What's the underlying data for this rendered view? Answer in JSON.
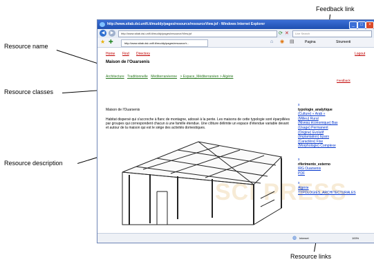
{
  "annotations": {
    "resource_name": "Resource name",
    "resource_classes": "Resource classes",
    "resource_description": "Resource description",
    "feedback_link": "Feedback link",
    "resource_links": "Resource links"
  },
  "browser": {
    "title": "http://www.sitab.dsi.unifi.it/muddy/pages/resource/resourceView.jsf - Windows Internet Explorer",
    "address": "http://www.sitab.dsi.unifi.it/muddy/pages/resource/View.jsf",
    "search_placeholder": "Live Search",
    "tab_label": "http://www.sitab.dsi.unifi.it/muddy/pages/resource/r...",
    "page_menu": "Pagina",
    "tools_menu": "Strumenti",
    "status_zone": "Internet",
    "zoom": "100%"
  },
  "page": {
    "nav_home": "Home",
    "nav_find": "Find",
    "nav_directory": "Directory",
    "logout": "Logout",
    "resource_name": "Maison de l'Ouarsenis",
    "classes": [
      "Architecture",
      "Traditionnelle",
      "Méditerranéenne",
      "> Espace_Méditerranéen > Algérie"
    ],
    "feedback": "Feedback",
    "description_title": "Maison de l'Ouarsenis",
    "description_body": "Habitat dispersé qui s'accroche à flanc de montagne, adossé à la pente. Les maisons de cette typologie sont éparpillées par groupes qui correspondent chacun à une famille étendue. Une clôture délimite un espace d'étendue variable devant et autour de la maison qui est le siège des activités domestiques.",
    "sidebar": {
      "typologie_head": "typologie_analytique",
      "typologie_links": [
        "(Culture) « Arab »",
        "(Milieu) Rural",
        "(Niveau économique) Bas",
        "(Usage) Permanent",
        "(Origine) Evolutif",
        "(Implantation) Epars",
        "(Caractère) Fixe",
        "(Morphologie) Complexe"
      ],
      "riferimento_head": "riferimento_esterno",
      "riferimento_links": [
        "IRG Ouarsenis",
        "PDF"
      ],
      "other_links": [
        "Algérie",
        "TYPOLOGIES_ARCHITECTURALES"
      ]
    }
  }
}
